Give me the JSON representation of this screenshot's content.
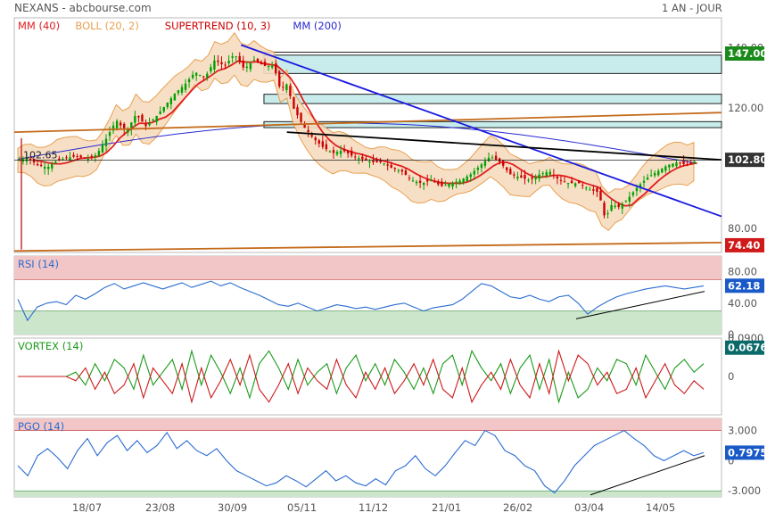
{
  "header": {
    "title": "NEXANS - abcbourse.com",
    "period": "1 AN - JOUR"
  },
  "colors": {
    "price_up": "#00a000",
    "price_down": "#cc0000",
    "mm40": "#e02020",
    "boll": "#e8a050",
    "boll_fill": "#f6dcc0",
    "supertrend_up": "#2ca02c",
    "supertrend_down": "#cc0000",
    "mm200": "#2a2ad0",
    "trend_blue": "#1a1ae0",
    "trend_orange": "#c46a1a",
    "trend_black": "#000000",
    "zone_fill": "#c8ecec",
    "rsi_line": "#2a6cd0",
    "vortex_plus": "#1a9a1a",
    "vortex_minus": "#cc1a1a",
    "pgo_line": "#2a6cd0",
    "overbought": "#f2c6c6",
    "oversold": "#cce6cc",
    "badge_green": "#1a8a1a",
    "badge_red": "#d01a1a",
    "badge_dark": "#333333",
    "badge_blue": "#1a5ac8",
    "badge_teal": "#0a6a6a"
  },
  "chart_data": [
    {
      "type": "candlestick",
      "panel": "price",
      "legend": [
        {
          "label": "MM (40)",
          "color": "#e02020"
        },
        {
          "label": "BOLL (20, 2)",
          "color": "#e8a050"
        },
        {
          "label": "SUPERTREND (10, 3)",
          "color": "#cc0000"
        },
        {
          "label": "MM (200)",
          "color": "#2a2ad0"
        }
      ],
      "ylim": [
        72,
        150
      ],
      "yticks": [
        "140.00",
        "120.00",
        "80.00"
      ],
      "ytick_values": [
        140,
        120,
        80
      ],
      "xticks": [
        "18/07",
        "23/08",
        "30/09",
        "05/11",
        "11/12",
        "21/01",
        "26/02",
        "03/04",
        "14/05"
      ],
      "badges": [
        {
          "label": "147.00",
          "value": 147,
          "color": "#1a8a1a"
        },
        {
          "label": "102.80",
          "value": 102.8,
          "color": "#333333"
        },
        {
          "label": "74.40",
          "value": 74.4,
          "color": "#d01a1a"
        }
      ],
      "annotation": "102.65",
      "close_path": [
        [
          0,
          102.6
        ],
        [
          6,
          103.5
        ],
        [
          12,
          101
        ],
        [
          18,
          100.3
        ],
        [
          24,
          102.6
        ],
        [
          30,
          103.5
        ],
        [
          36,
          104
        ],
        [
          42,
          103
        ],
        [
          48,
          104.5
        ],
        [
          54,
          110
        ],
        [
          60,
          116
        ],
        [
          66,
          112
        ],
        [
          72,
          118
        ],
        [
          78,
          114
        ],
        [
          84,
          117
        ],
        [
          90,
          121
        ],
        [
          96,
          125
        ],
        [
          102,
          128
        ],
        [
          108,
          132
        ],
        [
          114,
          130
        ],
        [
          120,
          136
        ],
        [
          126,
          134
        ],
        [
          132,
          138
        ],
        [
          138,
          133
        ],
        [
          144,
          136
        ],
        [
          150,
          134
        ],
        [
          156,
          134
        ],
        [
          160,
          126
        ],
        [
          164,
          128
        ],
        [
          168,
          120
        ],
        [
          174,
          114
        ],
        [
          180,
          110
        ],
        [
          186,
          107
        ],
        [
          192,
          105
        ],
        [
          198,
          106
        ],
        [
          204,
          104
        ],
        [
          210,
          103
        ],
        [
          216,
          102
        ],
        [
          222,
          102
        ],
        [
          228,
          100
        ],
        [
          234,
          99
        ],
        [
          240,
          96
        ],
        [
          246,
          95
        ],
        [
          252,
          96
        ],
        [
          258,
          94
        ],
        [
          264,
          95
        ],
        [
          270,
          96
        ],
        [
          276,
          98
        ],
        [
          282,
          101
        ],
        [
          288,
          104
        ],
        [
          294,
          102
        ],
        [
          300,
          98
        ],
        [
          306,
          97
        ],
        [
          312,
          96
        ],
        [
          318,
          98
        ],
        [
          324,
          99
        ],
        [
          330,
          96
        ],
        [
          336,
          95
        ],
        [
          342,
          95
        ],
        [
          348,
          93
        ],
        [
          354,
          92
        ],
        [
          358,
          83
        ],
        [
          362,
          88
        ],
        [
          366,
          87
        ],
        [
          372,
          90
        ],
        [
          378,
          94
        ],
        [
          384,
          97
        ],
        [
          390,
          99
        ],
        [
          396,
          101
        ],
        [
          402,
          102
        ],
        [
          408,
          101
        ],
        [
          414,
          102.8
        ]
      ],
      "x_domain": [
        0,
        418
      ]
    },
    {
      "type": "line",
      "panel": "rsi",
      "title": "RSI (14)",
      "ylim": [
        0,
        100
      ],
      "yticks": [
        "80.00",
        "40.00",
        "0"
      ],
      "ytick_values": [
        80,
        40,
        0
      ],
      "zones": {
        "overbought": 70,
        "oversold": 30
      },
      "badge": {
        "label": "62.18",
        "value": 62.18
      },
      "series": [
        {
          "values": [
            45,
            18,
            35,
            40,
            42,
            38,
            50,
            45,
            52,
            60,
            65,
            58,
            62,
            66,
            62,
            58,
            62,
            66,
            60,
            64,
            68,
            62,
            66,
            60,
            55,
            50,
            44,
            38,
            36,
            40,
            35,
            30,
            34,
            38,
            36,
            33,
            35,
            32,
            35,
            38,
            40,
            35,
            30,
            34,
            36,
            38,
            45,
            55,
            65,
            62,
            55,
            48,
            46,
            50,
            45,
            42,
            48,
            50,
            40,
            26,
            35,
            42,
            48,
            52,
            55,
            58,
            60,
            62,
            60,
            58,
            60,
            62
          ]
        }
      ]
    },
    {
      "type": "line",
      "panel": "vortex",
      "title": "VORTEX (14)",
      "ylim": [
        -0.09,
        0.09
      ],
      "yticks": [
        "0.0900",
        "0"
      ],
      "ytick_values": [
        0.09,
        0
      ],
      "badge": {
        "label": "0.0676",
        "value": 0.0676
      },
      "series": [
        {
          "values": [
            0,
            0,
            0,
            0,
            0,
            0,
            0.01,
            -0.02,
            0.03,
            -0.01,
            0.04,
            0.02,
            -0.03,
            0.05,
            -0.02,
            0.01,
            0.04,
            -0.03,
            0.06,
            -0.02,
            0.05,
            0.01,
            -0.04,
            0.02,
            -0.05,
            0.03,
            0.06,
            0.02,
            -0.03,
            0.04,
            -0.02,
            0.01,
            0.03,
            -0.04,
            0.02,
            0.05,
            -0.01,
            0.03,
            -0.02,
            0.04,
            0.01,
            -0.03,
            0.02,
            -0.04,
            0.03,
            0.05,
            -0.02,
            0.06,
            0.02,
            -0.01,
            0.03,
            -0.04,
            0.02,
            0.05,
            -0.03,
            0.04,
            -0.06,
            0.01,
            -0.05,
            -0.03,
            0.02,
            -0.01,
            0.04,
            0.03,
            -0.02,
            0.05,
            0.01,
            -0.03,
            0.02,
            0.04,
            0.01,
            0.03
          ]
        },
        {
          "values": [
            0,
            0,
            0,
            0,
            0,
            0,
            -0.01,
            0.02,
            -0.03,
            0.01,
            -0.04,
            -0.02,
            0.03,
            -0.05,
            0.02,
            -0.01,
            -0.04,
            0.03,
            -0.06,
            0.02,
            -0.05,
            -0.01,
            0.04,
            -0.02,
            0.05,
            -0.03,
            -0.06,
            -0.02,
            0.03,
            -0.04,
            0.02,
            -0.01,
            -0.03,
            0.04,
            -0.02,
            -0.05,
            0.01,
            -0.03,
            0.02,
            -0.04,
            -0.01,
            0.03,
            -0.02,
            0.04,
            -0.03,
            -0.05,
            0.02,
            -0.06,
            -0.02,
            0.01,
            -0.03,
            0.04,
            -0.02,
            -0.05,
            0.03,
            -0.04,
            0.06,
            -0.01,
            0.05,
            0.03,
            -0.02,
            0.01,
            -0.04,
            -0.03,
            0.02,
            -0.05,
            -0.01,
            0.03,
            -0.02,
            -0.04,
            -0.01,
            -0.03
          ]
        }
      ]
    },
    {
      "type": "line",
      "panel": "pgo",
      "title": "PGO (14)",
      "ylim": [
        -3.6,
        4.2
      ],
      "yticks": [
        "3.000",
        "0",
        "-3.000"
      ],
      "ytick_values": [
        3,
        0,
        -3
      ],
      "zones": {
        "overbought": 3,
        "oversold": -3
      },
      "badge": {
        "label": "0.7975",
        "value": 0.7975
      },
      "series": [
        {
          "values": [
            -0.5,
            -1.5,
            0.5,
            1.2,
            0.3,
            -0.8,
            1.0,
            2.2,
            0.5,
            1.8,
            2.5,
            1.0,
            2.0,
            0.8,
            1.5,
            2.8,
            1.2,
            2.0,
            1.0,
            0.5,
            1.2,
            0.0,
            -1.0,
            -1.5,
            -2.0,
            -2.5,
            -2.2,
            -1.5,
            -2.0,
            -2.6,
            -1.8,
            -1.0,
            -2.0,
            -1.5,
            -2.2,
            -2.5,
            -1.8,
            -2.4,
            -1.0,
            -0.5,
            0.5,
            -0.8,
            -1.5,
            -0.5,
            0.8,
            2.0,
            1.5,
            3.0,
            2.5,
            1.0,
            0.5,
            -0.5,
            -1.0,
            -2.5,
            -3.2,
            -2.0,
            -0.5,
            0.5,
            1.5,
            2.0,
            2.5,
            3.0,
            2.2,
            1.5,
            0.5,
            0.0,
            0.5,
            1.0,
            0.5,
            0.8
          ]
        }
      ]
    }
  ]
}
